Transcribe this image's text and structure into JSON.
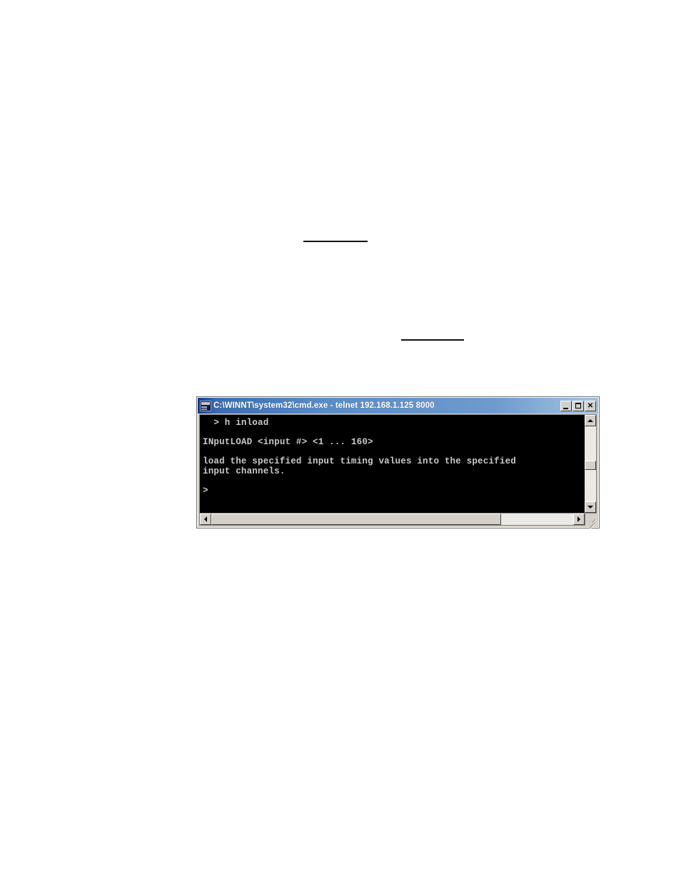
{
  "page": {
    "background_color": "#ffffff",
    "rules": [
      {
        "name": "underline-rule-upper"
      },
      {
        "name": "underline-rule-lower"
      }
    ]
  },
  "console_window": {
    "title": "C:\\WINNT\\system32\\cmd.exe - telnet 192.168.1.125 8000",
    "icon": "cmd-console-icon",
    "titlebar_color": "#3a6cb0",
    "window_face_color": "#d4d0c8",
    "screen_background": "#000000",
    "screen_foreground": "#c8c8c8",
    "buttons": {
      "minimize_label": "_",
      "maximize_label": "□",
      "close_label": "✕"
    },
    "screen_lines": [
      "  > h inload",
      "",
      "INputLOAD <input #> <1 ... 160>",
      "",
      "load the specified input timing values into the specified",
      "input channels.",
      "",
      ">"
    ],
    "scrollbars": {
      "vertical": {
        "up_arrow": "▲",
        "down_arrow": "▼",
        "thumb_position_percent": 46
      },
      "horizontal": {
        "left_arrow": "◀",
        "right_arrow": "▶",
        "thumb_width_percent": 80
      }
    },
    "resize_grip": "resize-grip-icon"
  }
}
